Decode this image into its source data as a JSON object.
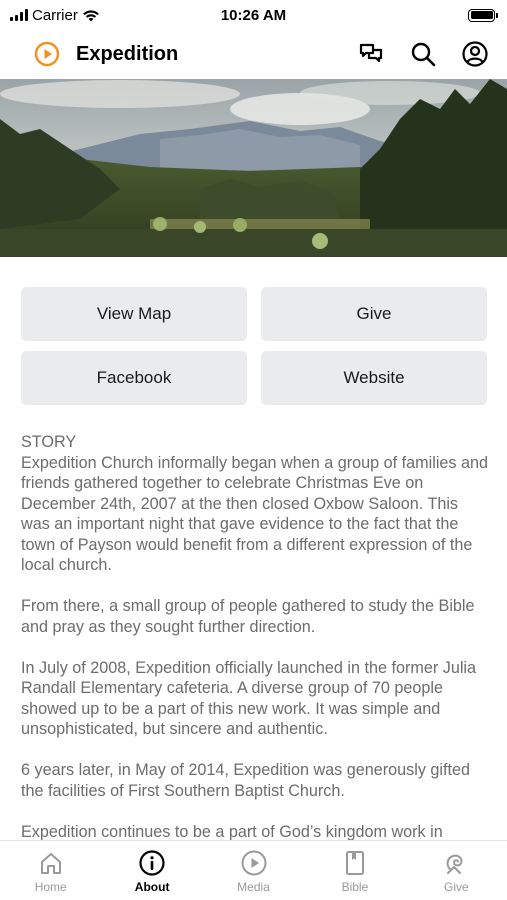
{
  "status_bar": {
    "carrier": "Carrier",
    "time": "10:26 AM"
  },
  "header": {
    "title": "Expedition",
    "brand_color": "#f0901e",
    "icons": [
      "brand-play-icon",
      "chat-icon",
      "search-icon",
      "account-icon"
    ]
  },
  "actions": {
    "view_map": "View Map",
    "give": "Give",
    "facebook": "Facebook",
    "website": "Website"
  },
  "story": {
    "heading": "STORY",
    "paragraphs": [
      "Expedition Church informally began when a group of families and friends gathered together to celebrate Christmas Eve on December 24th, 2007 at the then closed Oxbow Saloon. This was an important night that gave evidence to the fact that the town of Payson would benefit from a different expression of the local church.",
      "From there, a small group of people gathered to study the Bible and pray as they sought further direction.",
      "In July of 2008, Expedition officially launched in the former Julia Randall Elementary cafeteria. A diverse group of 70 people showed up to be a part of this new work. It was simple and unsophisticated, but sincere and authentic.",
      "6 years later, in May of 2014, Expedition was generously gifted the facilities of First Southern Baptist Church.",
      "Expedition continues to be a part of God’s kingdom work in"
    ]
  },
  "tabs": [
    {
      "label": "Home",
      "icon": "home-icon",
      "active": false
    },
    {
      "label": "About",
      "icon": "info-icon",
      "active": true
    },
    {
      "label": "Media",
      "icon": "play-icon",
      "active": false
    },
    {
      "label": "Bible",
      "icon": "bible-icon",
      "active": false
    },
    {
      "label": "Give",
      "icon": "give-icon",
      "active": false
    }
  ]
}
